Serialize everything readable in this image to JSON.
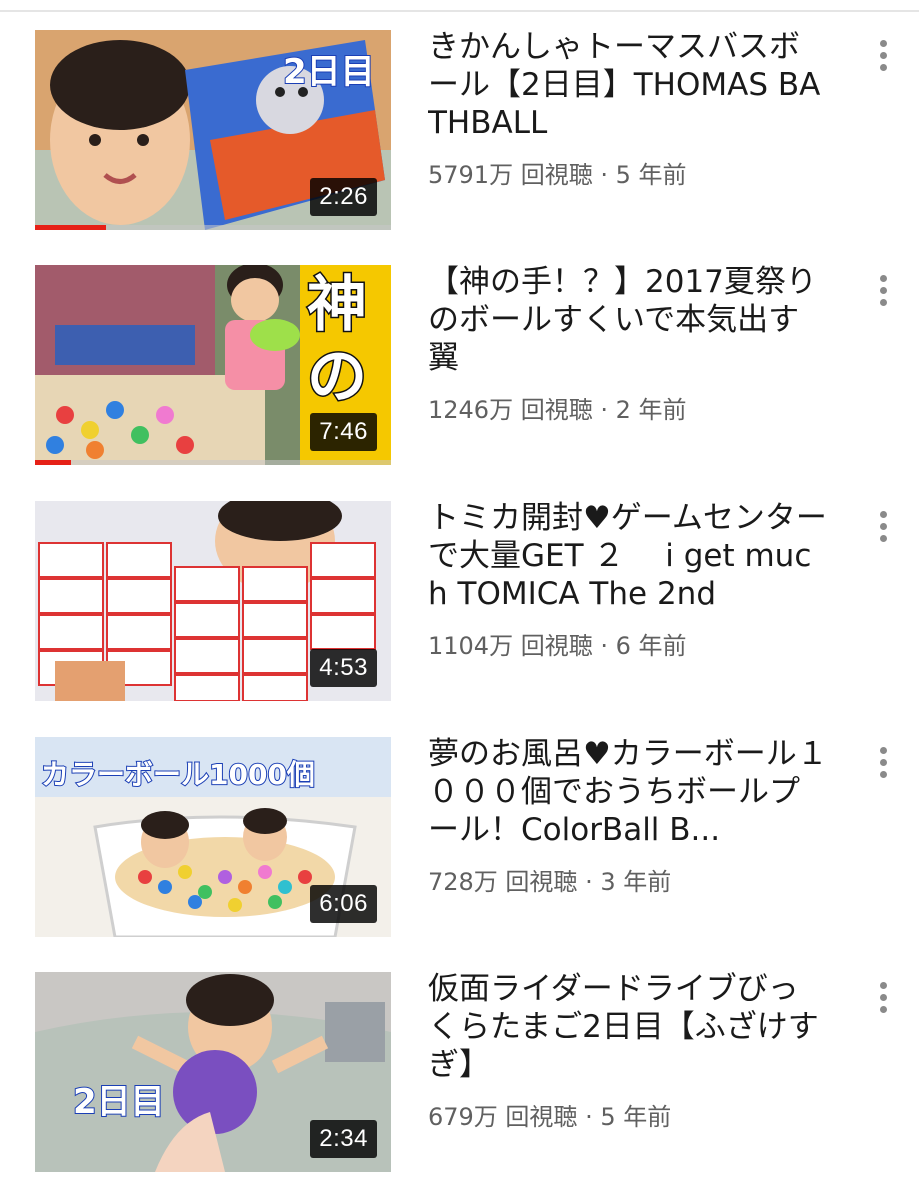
{
  "videos": [
    {
      "title": "きかんしゃトーマスバスボール【2日目】THOMAS BATHBALL",
      "views": "5791万 回視聴",
      "separator": "·",
      "age": "5 年前",
      "duration": "2:26",
      "watched_fraction": 0.2,
      "thumb_overlay": "2日目",
      "thumb_bg": "#d9a46f"
    },
    {
      "title": "【神の手！？】2017夏祭りのボールすくいで本気出す翼",
      "views": "1246万 回視聴",
      "separator": "·",
      "age": "2 年前",
      "duration": "7:46",
      "watched_fraction": 0.1,
      "thumb_overlay": "神の",
      "thumb_bg": "#7a8c6a"
    },
    {
      "title": "トミカ開封♥ゲームセンターで大量GET ２　 i get much TOMICA The 2nd",
      "views": "1104万 回視聴",
      "separator": "·",
      "age": "6 年前",
      "duration": "4:53",
      "watched_fraction": 0,
      "thumb_overlay": "",
      "thumb_bg": "#e8e8ee"
    },
    {
      "title": "夢のお風呂♥カラーボール１０００個でおうちボールプール！ColorBall B...",
      "views": "728万 回視聴",
      "separator": "·",
      "age": "3 年前",
      "duration": "6:06",
      "watched_fraction": 0,
      "thumb_overlay": "カラーボール1000個",
      "thumb_bg": "#f3f0ea"
    },
    {
      "title": "仮面ライダードライブびっくらたまご2日目【ふざけすぎ】",
      "views": "679万 回視聴",
      "separator": "·",
      "age": "5 年前",
      "duration": "2:34",
      "watched_fraction": 0,
      "thumb_overlay": "2日目",
      "thumb_bg": "#c9c7c4"
    }
  ],
  "icons": {
    "more": "more-vert-icon"
  },
  "colors": {
    "progress": "#e62117",
    "meta_text": "#606060",
    "title_text": "#1a1a1a"
  }
}
